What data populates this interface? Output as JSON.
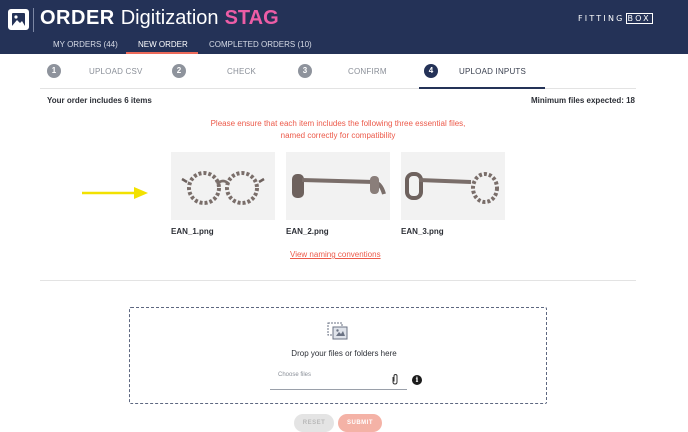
{
  "header": {
    "title_strong": "ORDER",
    "title_light": "Digitization",
    "title_env": "STAG",
    "brand_left": "FITTING",
    "brand_box": "BOX",
    "brand_color": "#243257",
    "accent_color": "#ec5da6"
  },
  "nav": {
    "my_orders": "MY ORDERS (44)",
    "new_order": "NEW ORDER",
    "completed_orders": "COMPLETED ORDERS (10)"
  },
  "steps": [
    {
      "number": "1",
      "label": "UPLOAD CSV"
    },
    {
      "number": "2",
      "label": "CHECK"
    },
    {
      "number": "3",
      "label": "CONFIRM"
    },
    {
      "number": "4",
      "label": "UPLOAD INPUTS"
    }
  ],
  "active_step": 4,
  "order": {
    "info": "Your order includes 6 items",
    "min_files": "Minimum files expected: 18"
  },
  "warning": "Please ensure that each item includes the following three essential files, named correctly for compatibility",
  "files": [
    {
      "name": "EAN_1.png",
      "icon": "glasses-front-image"
    },
    {
      "name": "EAN_2.png",
      "icon": "glasses-side-image"
    },
    {
      "name": "EAN_3.png",
      "icon": "glasses-three-quarter-image"
    }
  ],
  "naming_link": "View naming conventions",
  "dropzone": {
    "text": "Drop your files or folders here",
    "placeholder": "Choose files",
    "icon": "file-upload-icon"
  },
  "buttons": {
    "reset": "RESET",
    "submit": "SUBMIT"
  },
  "colors": {
    "warning": "#ec5a4a",
    "submit": "#f4b2a6",
    "arrow": "#f2e100"
  }
}
